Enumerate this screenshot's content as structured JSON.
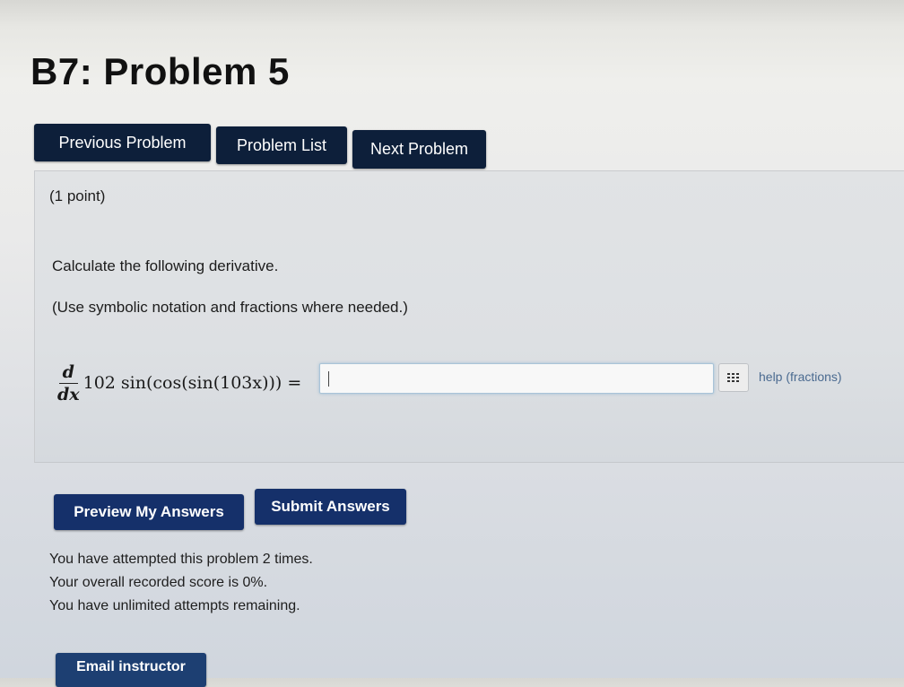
{
  "page": {
    "title": "B7: Problem 5"
  },
  "nav": {
    "previous_label": "Previous Problem",
    "list_label": "Problem List",
    "next_label": "Next Problem"
  },
  "problem": {
    "points": "(1 point)",
    "instruction": "Calculate the following derivative.",
    "hint": "(Use symbolic notation and fractions where needed.)",
    "derivative_numerator": "d",
    "derivative_denominator": "dx",
    "expression": "102 sin(cos(sin(103x))) =",
    "answer_value": "",
    "help_label": "help (fractions)",
    "palette_icon": "grid-icon"
  },
  "actions": {
    "preview_label": "Preview My Answers",
    "submit_label": "Submit Answers"
  },
  "status": {
    "attempts_line": "You have attempted this problem 2 times.",
    "score_line": "Your overall recorded score is 0%.",
    "remaining_line": "You have unlimited attempts remaining."
  },
  "footer": {
    "email_label": "Email instructor"
  },
  "colors": {
    "button_dark": "#0d1f3a",
    "button_blue": "#15306a",
    "help_link": "#4a6a90"
  }
}
